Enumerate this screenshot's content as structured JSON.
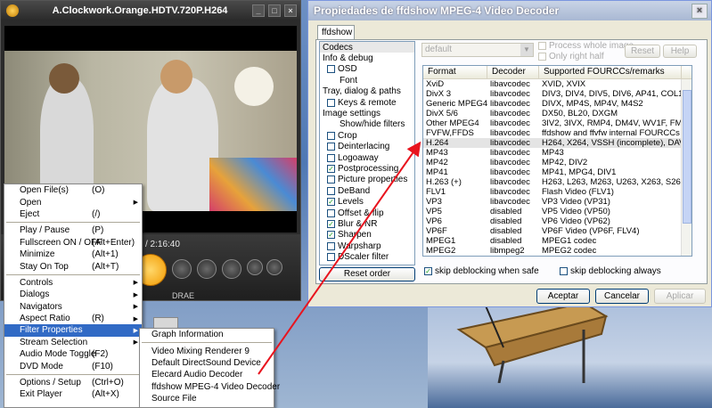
{
  "player": {
    "title": "A.Clockwork.Orange.HDTV.720P.H264",
    "min_btn": "_",
    "max_btn": "□",
    "close_btn": "×",
    "time": "/ 2:16:40",
    "drae": "DRAE"
  },
  "dialog": {
    "title": "Propiedades de ffdshow MPEG-4 Video Decoder",
    "close_btn": "×",
    "tab": "ffdshow",
    "preset": "default",
    "process_whole_image": "Process whole image",
    "only_right_half": "Only right half",
    "reset_label": "Reset",
    "help_label": "Help",
    "reset_order_label": "Reset order",
    "skip_deblocking_safe": "skip deblocking when safe",
    "skip_deblocking_always": "skip deblocking always",
    "ok_label": "Aceptar",
    "cancel_label": "Cancelar",
    "apply_label": "Aplicar"
  },
  "tree": [
    {
      "label": "Codecs",
      "level": 0,
      "check": null,
      "selected": true
    },
    {
      "label": "Info & debug",
      "level": 0,
      "check": null
    },
    {
      "label": "OSD",
      "level": 1,
      "check": false
    },
    {
      "label": "Font",
      "level": 2,
      "check": null
    },
    {
      "label": "Tray, dialog & paths",
      "level": 0,
      "check": null
    },
    {
      "label": "Keys & remote",
      "level": 1,
      "check": false
    },
    {
      "label": "Image settings",
      "level": 0,
      "check": null
    },
    {
      "label": "Show/hide filters",
      "level": 2,
      "check": null
    },
    {
      "label": "Crop",
      "level": 1,
      "check": false
    },
    {
      "label": "Deinterlacing",
      "level": 1,
      "check": false
    },
    {
      "label": "Logoaway",
      "level": 1,
      "check": false
    },
    {
      "label": "Postprocessing",
      "level": 1,
      "check": true
    },
    {
      "label": "Picture properties",
      "level": 1,
      "check": false
    },
    {
      "label": "DeBand",
      "level": 1,
      "check": false
    },
    {
      "label": "Levels",
      "level": 1,
      "check": true
    },
    {
      "label": "Offset & flip",
      "level": 1,
      "check": false
    },
    {
      "label": "Blur & NR",
      "level": 1,
      "check": true
    },
    {
      "label": "Sharpen",
      "level": 1,
      "check": true
    },
    {
      "label": "Warpsharp",
      "level": 1,
      "check": false
    },
    {
      "label": "DScaler filter",
      "level": 1,
      "check": false
    }
  ],
  "table": {
    "headers": [
      "Format",
      "Decoder",
      "Supported FOURCCs/remarks"
    ],
    "rows": [
      [
        "XviD",
        "libavcodec",
        "XVID, XVIX"
      ],
      [
        "DivX 3",
        "libavcodec",
        "DIV3, DIV4, DIV5, DIV6, AP41, COL1..."
      ],
      [
        "Generic MPEG4",
        "libavcodec",
        "DIVX, MP4S, MP4V, M4S2"
      ],
      [
        "DivX 5/6",
        "libavcodec",
        "DX50, BL20, DXGM"
      ],
      [
        "Other MPEG4",
        "libavcodec",
        "3IV2, 3IVX, RMP4, DM4V, WV1F, FM..."
      ],
      [
        "FVFW,FFDS",
        "libavcodec",
        "ffdshow and ffvfw internal FOURCCs"
      ],
      [
        "H.264",
        "libavcodec",
        "H264, X264, VSSH (incomplete), DAV..."
      ],
      [
        "MP43",
        "libavcodec",
        "MP43"
      ],
      [
        "MP42",
        "libavcodec",
        "MP42, DIV2"
      ],
      [
        "MP41",
        "libavcodec",
        "MP41, MPG4, DIV1"
      ],
      [
        "H.263 (+)",
        "libavcodec",
        "H263, L263, M263, U263, X263, S26..."
      ],
      [
        "FLV1",
        "libavcodec",
        "Flash Video (FLV1)"
      ],
      [
        "VP3",
        "libavcodec",
        "VP3 Video (VP31)"
      ],
      [
        "VP5",
        "disabled",
        "VP5 Video (VP50)"
      ],
      [
        "VP6",
        "disabled",
        "VP6 Video (VP62)"
      ],
      [
        "VP6F",
        "disabled",
        "VP6F Video (VP6F, FLV4)"
      ],
      [
        "MPEG1",
        "disabled",
        "MPEG1 codec"
      ],
      [
        "MPEG2",
        "libmpeg2",
        "MPEG2 codec"
      ]
    ],
    "highlight_row": 6
  },
  "context_menu": [
    {
      "label": "Open File(s)",
      "acc": "(O)"
    },
    {
      "label": "Open",
      "acc": "",
      "submenu": true
    },
    {
      "label": "Eject",
      "acc": "(/)"
    },
    {
      "sep": true
    },
    {
      "label": "Play / Pause",
      "acc": "(P)"
    },
    {
      "label": "Fullscreen ON / OFF",
      "acc": "(Alt+Enter)"
    },
    {
      "label": "Minimize",
      "acc": "(Alt+1)"
    },
    {
      "label": "Stay On Top",
      "acc": "(Alt+T)"
    },
    {
      "sep": true
    },
    {
      "label": "Controls",
      "acc": "",
      "submenu": true
    },
    {
      "label": "Dialogs",
      "acc": "",
      "submenu": true
    },
    {
      "label": "Navigators",
      "acc": "",
      "submenu": true
    },
    {
      "label": "Aspect Ratio",
      "acc": "(R)",
      "submenu": true
    },
    {
      "label": "Filter Properties",
      "acc": "",
      "submenu": true,
      "highlight": true
    },
    {
      "label": "Stream Selection",
      "acc": "",
      "submenu": true
    },
    {
      "label": "Audio Mode Toggle",
      "acc": "(F2)"
    },
    {
      "label": "DVD Mode",
      "acc": "(F10)"
    },
    {
      "sep": true
    },
    {
      "label": "Options / Setup",
      "acc": "(Ctrl+O)"
    },
    {
      "label": "Exit Player",
      "acc": "(Alt+X)"
    }
  ],
  "submenu": [
    {
      "label": "Graph Information"
    },
    {
      "sep": true
    },
    {
      "label": "Video Mixing Renderer 9"
    },
    {
      "label": "Default DirectSound Device"
    },
    {
      "label": "Elecard Audio Decoder"
    },
    {
      "label": "ffdshow MPEG-4 Video Decoder"
    },
    {
      "label": "Source File"
    }
  ],
  "colors": {
    "menu_highlight": "#316ac5",
    "arrow": "#e8141e",
    "check": "#21a121"
  }
}
